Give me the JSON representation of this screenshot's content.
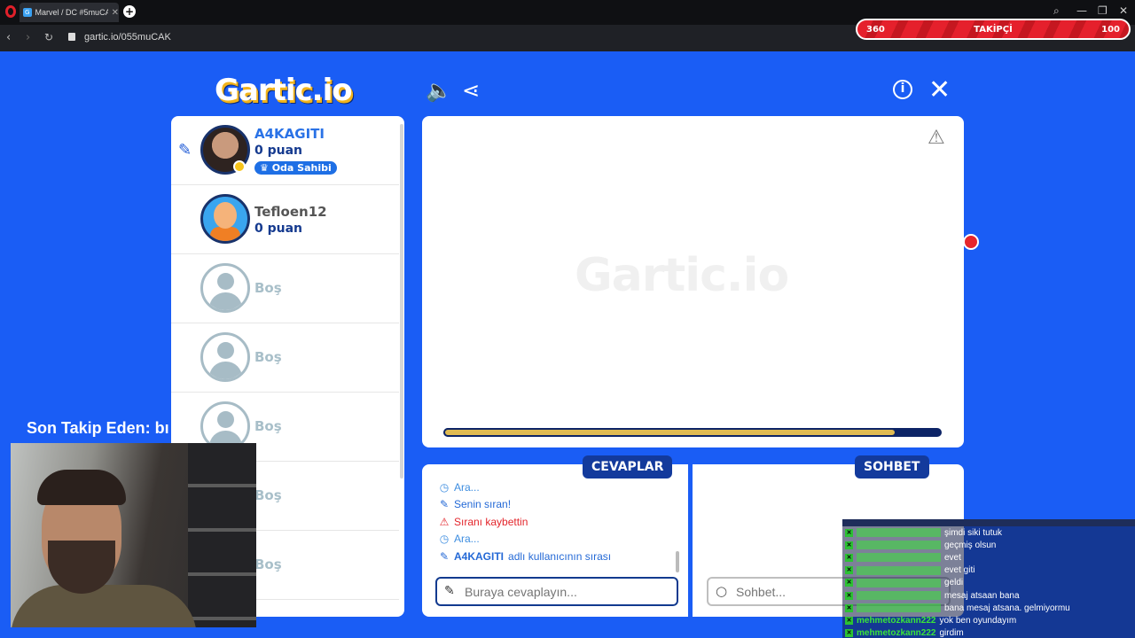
{
  "browser": {
    "tab_title": "Marvel / DC #5muCAK (1..",
    "tab_close": "✕",
    "new_tab": "+",
    "url": "gartic.io/055muCAK"
  },
  "takipci": {
    "left": "360",
    "label": "TAKİPÇİ",
    "right": "100"
  },
  "game": {
    "logo": "Gartic.io",
    "watermark": "Gartic.io",
    "timer_fraction": 0.91,
    "colors": {
      "background": "#1a5df5",
      "navy": "#133a9c",
      "timer": "#e0bb52",
      "accent_red": "#e5202c"
    }
  },
  "players": [
    {
      "name": "A4KAGITI",
      "score": "0 puan",
      "badge": "Oda Sahibi",
      "drawing": true,
      "avatar": "photo"
    },
    {
      "name": "Tefloen12",
      "score": "0 puan",
      "avatar": "cartoon"
    },
    {
      "name": "Boş",
      "avatar": "empty"
    },
    {
      "name": "Boş",
      "avatar": "empty"
    },
    {
      "name": "Boş",
      "avatar": "empty"
    },
    {
      "name": "Boş",
      "avatar": "empty"
    },
    {
      "name": "Boş",
      "avatar": "empty"
    }
  ],
  "answers": {
    "label": "CEVAPLAR",
    "placeholder": "Buraya cevaplayın...",
    "feed": [
      {
        "icon": "clock-icon",
        "glyph": "◷",
        "text": "Ara...",
        "color": "#3d8de0"
      },
      {
        "icon": "pencil-icon",
        "glyph": "✎",
        "text": "Senin sıran!",
        "color": "#2469d6"
      },
      {
        "icon": "warning-icon",
        "glyph": "⚠",
        "text": "Sıranı kaybettin",
        "color": "#e3252b"
      },
      {
        "icon": "clock-icon",
        "glyph": "◷",
        "text": "Ara...",
        "color": "#3d8de0"
      },
      {
        "icon": "pencil-icon",
        "glyph": "✎",
        "text_bold": "A4KAGITI",
        "text": " adlı kullanıcının sırası",
        "color": "#2469d6"
      }
    ]
  },
  "chat": {
    "label": "SOHBET",
    "placeholder": "Sohbet..."
  },
  "stream": {
    "last_follower_label": "Son Takip Eden: bı",
    "chat_lines": [
      {
        "user": "",
        "msg": "şimdi siki tutuk"
      },
      {
        "user": "",
        "msg": "geçmiş olsun"
      },
      {
        "user": "",
        "msg": "evet"
      },
      {
        "user": "",
        "msg": "evet giti"
      },
      {
        "user": "",
        "msg": "geldi"
      },
      {
        "user": "",
        "msg": "mesaj atsaan bana"
      },
      {
        "user": "",
        "msg": "bana mesaj atsana. gelmiyormu"
      },
      {
        "user": "mehmetozkann222",
        "msg": "yok ben oyundayım"
      },
      {
        "user": "mehmetozkann222",
        "msg": "girdim"
      }
    ]
  }
}
